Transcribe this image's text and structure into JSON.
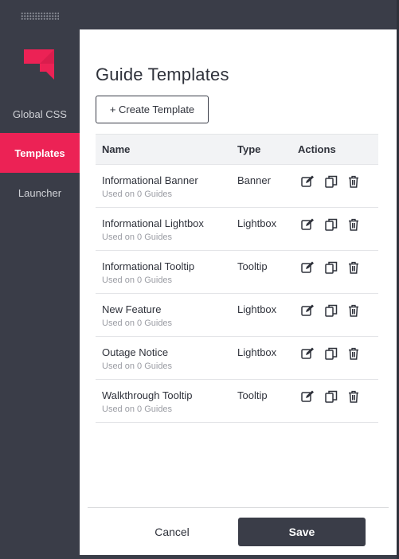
{
  "sidebar": {
    "items": [
      {
        "label": "Global CSS",
        "active": false
      },
      {
        "label": "Templates",
        "active": true
      },
      {
        "label": "Launcher",
        "active": false
      }
    ]
  },
  "main": {
    "title": "Guide Templates",
    "create_button": "+ Create Template",
    "table": {
      "headers": {
        "name": "Name",
        "type": "Type",
        "actions": "Actions"
      },
      "rows": [
        {
          "name": "Informational Banner",
          "usage": "Used on 0 Guides",
          "type": "Banner"
        },
        {
          "name": "Informational Lightbox",
          "usage": "Used on 0 Guides",
          "type": "Lightbox"
        },
        {
          "name": "Informational Tooltip",
          "usage": "Used on 0 Guides",
          "type": "Tooltip"
        },
        {
          "name": "New Feature",
          "usage": "Used on 0 Guides",
          "type": "Lightbox"
        },
        {
          "name": "Outage Notice",
          "usage": "Used on 0 Guides",
          "type": "Lightbox"
        },
        {
          "name": "Walkthrough Tooltip",
          "usage": "Used on 0 Guides",
          "type": "Tooltip"
        }
      ],
      "row_actions": [
        "edit-icon",
        "copy-icon",
        "trash-icon"
      ]
    }
  },
  "footer": {
    "cancel_label": "Cancel",
    "save_label": "Save"
  },
  "colors": {
    "brand": "#ec2255",
    "sidebar_bg": "#3a3d48",
    "active_nav_bg": "#ec2255",
    "save_bg": "#3a3d48"
  }
}
